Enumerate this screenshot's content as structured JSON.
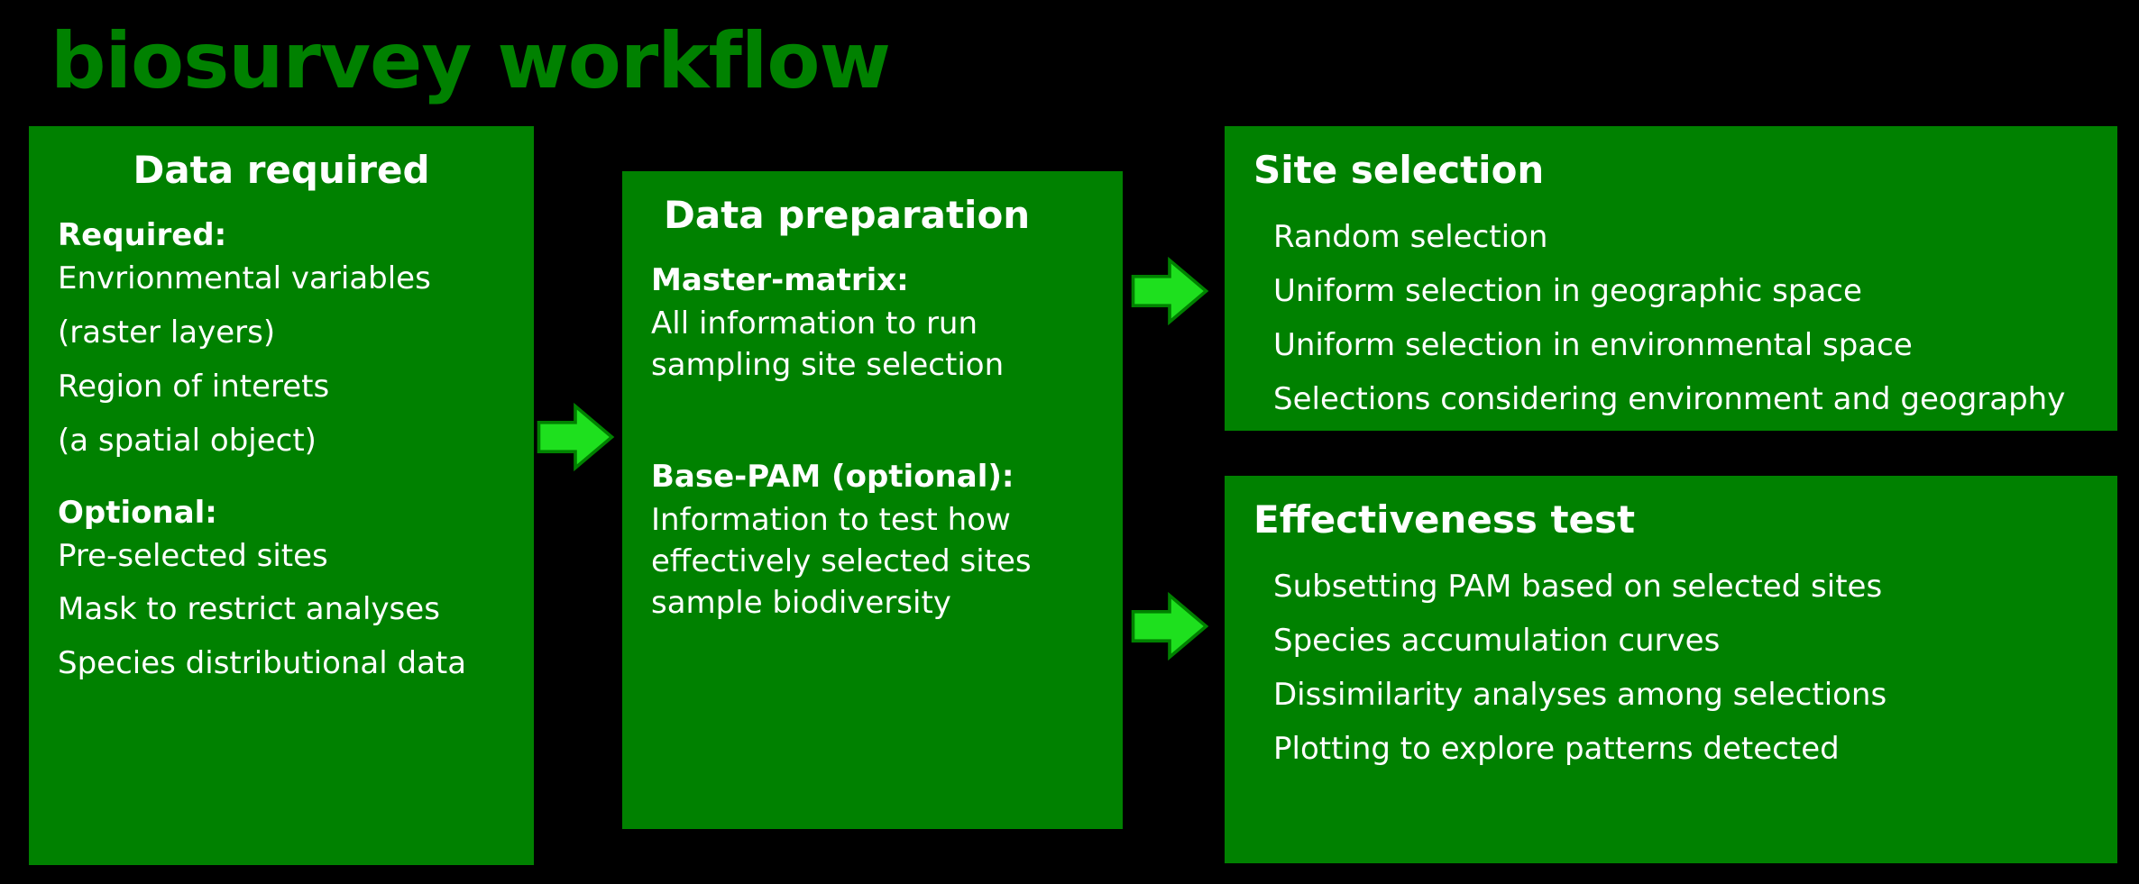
{
  "title": "biosurvey workflow",
  "boxes": {
    "data_required": {
      "title": "Data required",
      "required_label": "Required:",
      "required_items": [
        "Envrionmental variables",
        "(raster layers)",
        "Region of interets",
        "(a spatial object)"
      ],
      "optional_label": "Optional:",
      "optional_items": [
        "Pre-selected sites",
        "Mask to restrict analyses",
        "Species distributional data"
      ]
    },
    "data_preparation": {
      "title": "Data preparation",
      "master_matrix_label": "Master-matrix:",
      "master_matrix_desc": "All information to run sampling site selection",
      "base_pam_label": "Base-PAM (optional):",
      "base_pam_desc": "Information to test how effectively selected sites sample biodiversity"
    },
    "site_selection": {
      "title": "Site selection",
      "items": [
        "Random selection",
        "Uniform selection in geographic space",
        "Uniform selection in environmental space",
        "Selections considering environment and geography"
      ]
    },
    "effectiveness_test": {
      "title": "Effectiveness test",
      "items": [
        "Subsetting PAM based on selected sites",
        "Species accumulation curves",
        "Dissimilarity analyses among selections",
        "Plotting to explore patterns detected"
      ]
    }
  },
  "colors": {
    "background": "#000000",
    "box_fill": "#008100",
    "title_color": "#008100",
    "text_color": "#ffffff",
    "arrow_fill": "#1ee01e",
    "arrow_stroke": "#008100"
  }
}
